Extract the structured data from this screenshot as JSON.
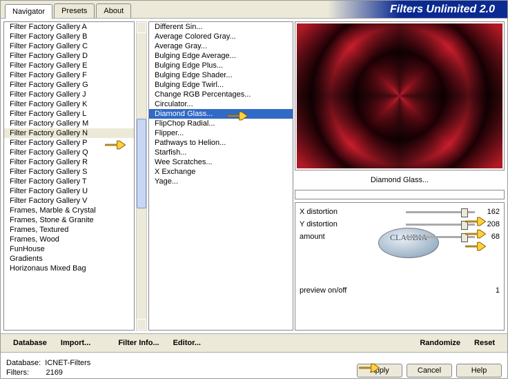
{
  "app_title": "Filters Unlimited 2.0",
  "tabs": [
    "Navigator",
    "Presets",
    "About"
  ],
  "active_tab": 0,
  "categories": [
    "Filter Factory Gallery A",
    "Filter Factory Gallery B",
    "Filter Factory Gallery C",
    "Filter Factory Gallery D",
    "Filter Factory Gallery E",
    "Filter Factory Gallery F",
    "Filter Factory Gallery G",
    "Filter Factory Gallery J",
    "Filter Factory Gallery K",
    "Filter Factory Gallery L",
    "Filter Factory Gallery M",
    "Filter Factory Gallery N",
    "Filter Factory Gallery P",
    "Filter Factory Gallery Q",
    "Filter Factory Gallery R",
    "Filter Factory Gallery S",
    "Filter Factory Gallery T",
    "Filter Factory Gallery U",
    "Filter Factory Gallery V",
    "Frames, Marble & Crystal",
    "Frames, Stone & Granite",
    "Frames, Textured",
    "Frames, Wood",
    "FunHouse",
    "Gradients",
    "Horizonaus Mixed Bag"
  ],
  "selected_category_index": 11,
  "filters": [
    " Different Sin...",
    "Average Colored Gray...",
    "Average Gray...",
    "Bulging Edge Average...",
    "Bulging Edge Plus...",
    "Bulging Edge Shader...",
    "Bulging Edge Twirl...",
    "Change RGB Percentages...",
    "Circulator...",
    "Diamond Glass...",
    "FlipChop Radial...",
    "Flipper...",
    "Pathways to Helion...",
    "Starfish...",
    "Wee Scratches...",
    "X Exchange",
    "Yage..."
  ],
  "selected_filter_index": 9,
  "preview_label": "Diamond Glass...",
  "params": [
    {
      "label": "X distortion",
      "value": 162
    },
    {
      "label": "Y distortion",
      "value": 208
    },
    {
      "label": "amount",
      "value": 68
    }
  ],
  "preview_toggle": {
    "label": "preview on/off",
    "value": 1
  },
  "toolbar": {
    "database": "Database",
    "import": "Import...",
    "filterinfo": "Filter Info...",
    "editor": "Editor...",
    "randomize": "Randomize",
    "reset": "Reset"
  },
  "footer": {
    "db_label": "Database:",
    "db_value": "ICNET-Filters",
    "filters_label": "Filters:",
    "filters_value": "2169"
  },
  "buttons": {
    "apply": "Apply",
    "cancel": "Cancel",
    "help": "Help"
  },
  "badge_text": "CLAUDIA"
}
